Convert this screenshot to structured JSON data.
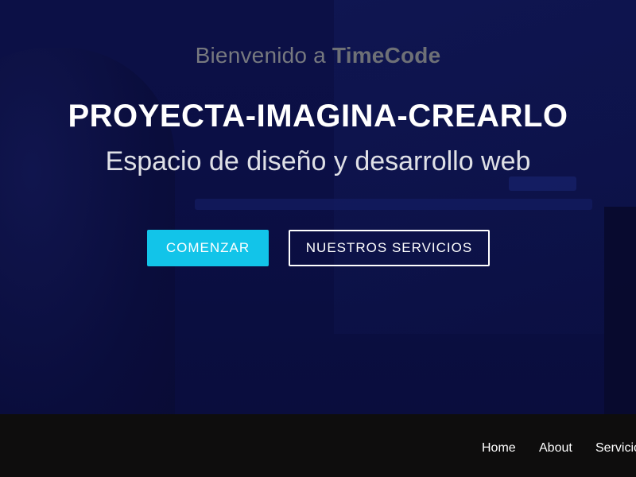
{
  "hero": {
    "welcome_prefix": "Bienvenido a ",
    "brand": "TimeCode",
    "headline": "PROYECTA-IMAGINA-CREARLO",
    "subline": "Espacio de diseño y desarrollo web",
    "primary_button": "COMENZAR",
    "secondary_button": "NUESTROS SERVICIOS"
  },
  "nav": {
    "items": [
      {
        "label": "Home"
      },
      {
        "label": "About"
      },
      {
        "label": "Servicios"
      }
    ]
  },
  "colors": {
    "hero_overlay": "#0b0f45",
    "primary_button": "#12c4e9",
    "navbar": "#0e0d0d",
    "text": "#ffffff"
  }
}
